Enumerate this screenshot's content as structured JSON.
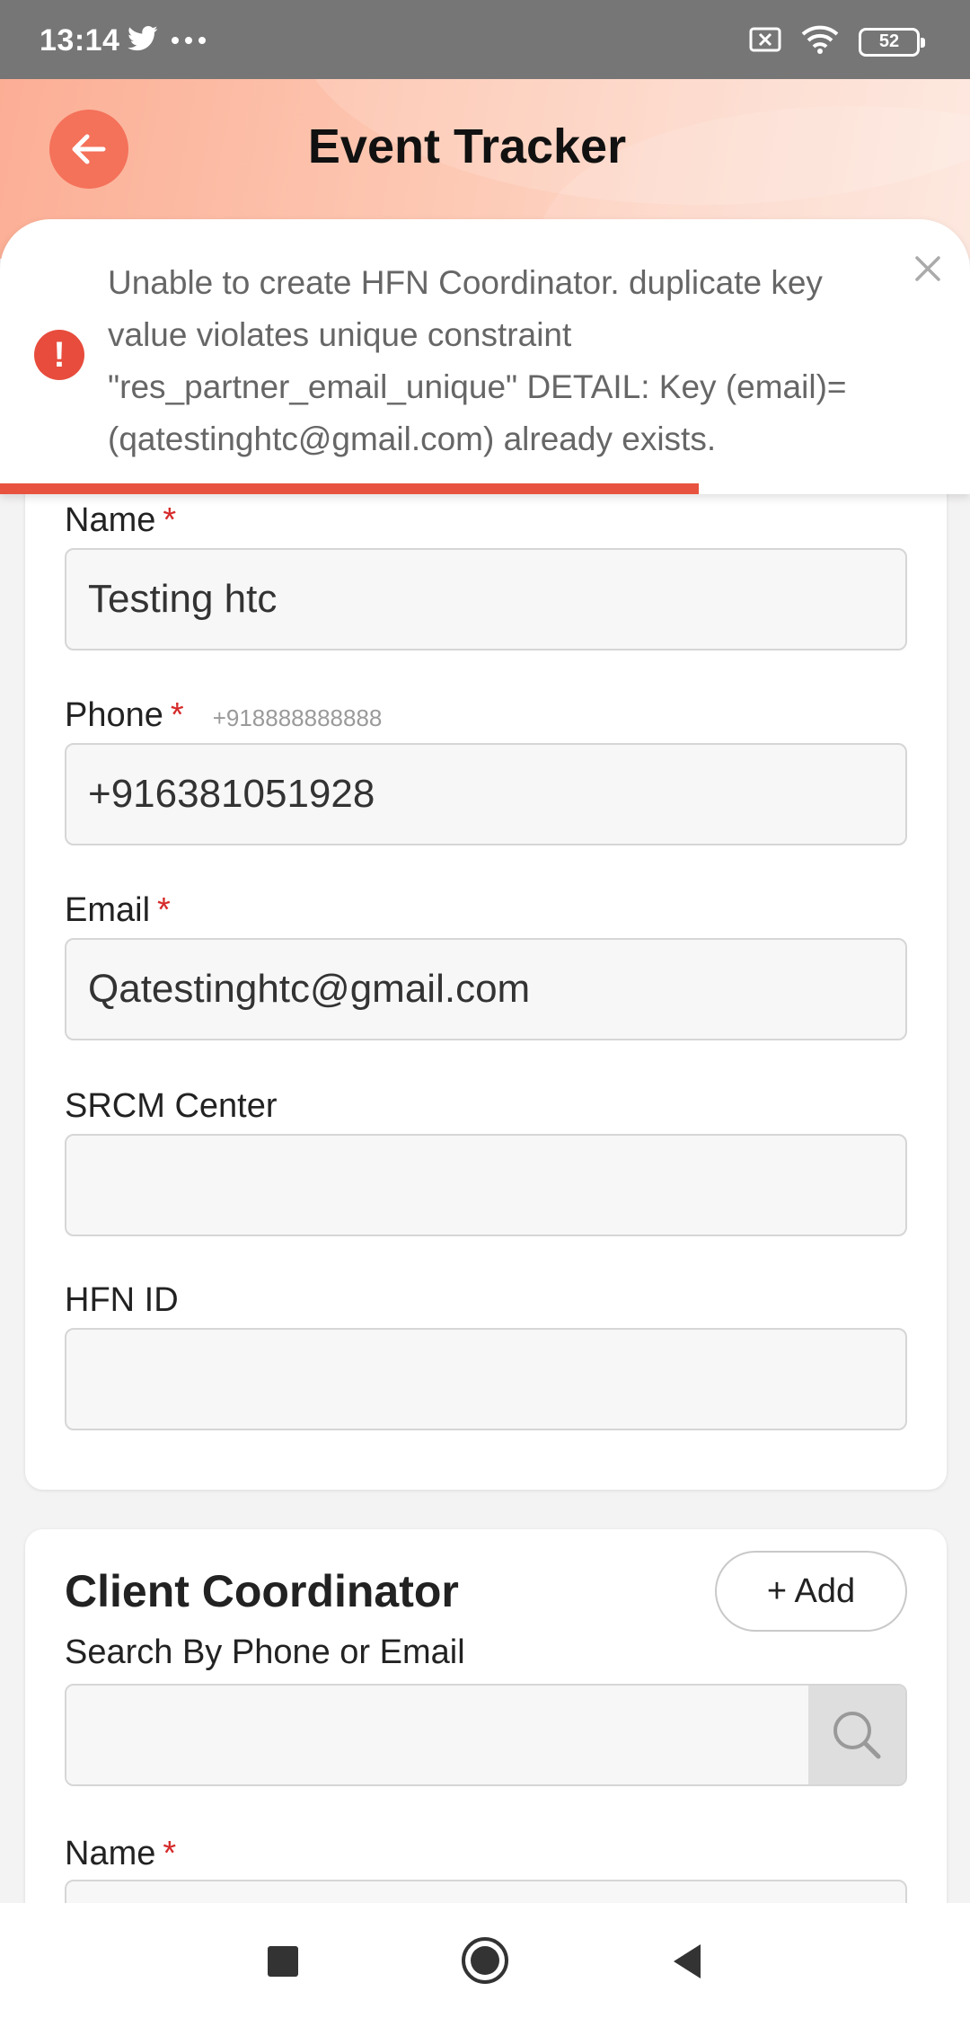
{
  "status_bar": {
    "time": "13:14",
    "left_icons": [
      "twitter-icon",
      "more-dots-icon"
    ],
    "right_icons": [
      "no-sim-icon",
      "wifi-icon",
      "battery-icon"
    ],
    "battery_level": "52"
  },
  "header": {
    "title": "Event Tracker",
    "accent_color": "#f4715a"
  },
  "toast": {
    "message": "Unable to create HFN Coordinator. duplicate key value violates unique constraint \"res_partner_email_unique\" DETAIL: Key (email)=(qatestinghtc@gmail.com) already exists.",
    "type": "error",
    "color": "#e74c3c",
    "progress": 0.72
  },
  "coordinator_form": {
    "name_label": "Name",
    "name_value": "Testing htc",
    "phone_label": "Phone",
    "phone_hint": "+918888888888",
    "phone_value": "+916381051928",
    "email_label": "Email",
    "email_value": "Qatestinghtc@gmail.com",
    "center_label": "SRCM Center",
    "center_value": "",
    "hfn_id_label": "HFN ID",
    "hfn_id_value": "",
    "required_marker": "*"
  },
  "client_coordinator": {
    "title": "Client Coordinator",
    "add_label": "+ Add",
    "search_label": "Search By Phone or Email",
    "search_value": "",
    "name_label": "Name",
    "required_marker": "*"
  },
  "nav_bar": {
    "buttons": [
      "recent-apps-icon",
      "home-icon",
      "back-triangle-icon"
    ]
  }
}
